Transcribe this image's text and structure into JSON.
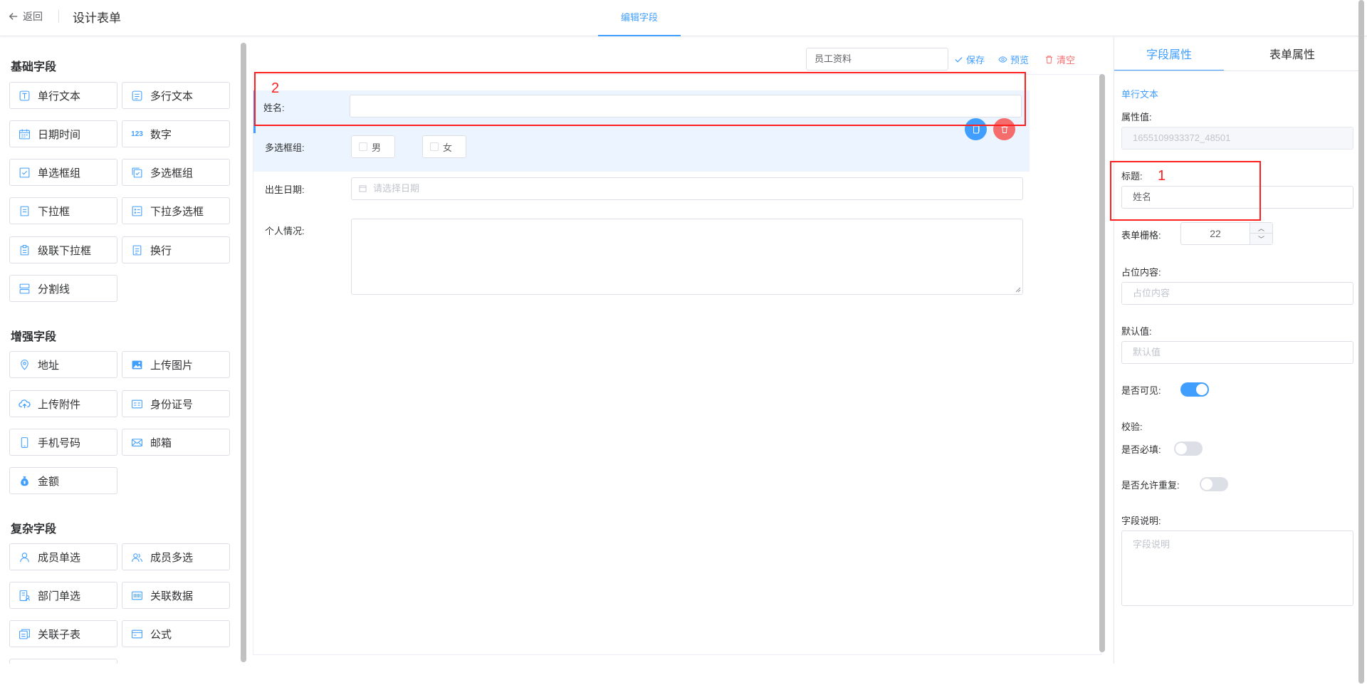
{
  "header": {
    "back_label": "返回",
    "title": "设计表单",
    "center_tab": "编辑字段"
  },
  "palette": {
    "groups": [
      {
        "title": "基础字段",
        "items": [
          {
            "label": "单行文本",
            "icon": "single-line-text-icon"
          },
          {
            "label": "多行文本",
            "icon": "multi-line-text-icon"
          },
          {
            "label": "日期时间",
            "icon": "calendar-icon"
          },
          {
            "label": "数字",
            "icon": "number-icon"
          },
          {
            "label": "单选框组",
            "icon": "radio-group-icon"
          },
          {
            "label": "多选框组",
            "icon": "checkbox-group-icon"
          },
          {
            "label": "下拉框",
            "icon": "dropdown-icon"
          },
          {
            "label": "下拉多选框",
            "icon": "multi-dropdown-icon"
          },
          {
            "label": "级联下拉框",
            "icon": "cascader-icon"
          },
          {
            "label": "换行",
            "icon": "line-break-icon"
          },
          {
            "label": "分割线",
            "icon": "divider-icon"
          }
        ]
      },
      {
        "title": "增强字段",
        "items": [
          {
            "label": "地址",
            "icon": "location-pin-icon"
          },
          {
            "label": "上传图片",
            "icon": "image-icon"
          },
          {
            "label": "上传附件",
            "icon": "cloud-upload-icon"
          },
          {
            "label": "身份证号",
            "icon": "id-card-icon"
          },
          {
            "label": "手机号码",
            "icon": "phone-icon"
          },
          {
            "label": "邮箱",
            "icon": "mail-icon"
          },
          {
            "label": "金额",
            "icon": "money-bag-icon"
          }
        ]
      },
      {
        "title": "复杂字段",
        "items": [
          {
            "label": "成员单选",
            "icon": "user-icon"
          },
          {
            "label": "成员多选",
            "icon": "users-icon"
          },
          {
            "label": "部门单选",
            "icon": "department-icon"
          },
          {
            "label": "关联数据",
            "icon": "barcode-icon"
          },
          {
            "label": "关联子表",
            "icon": "subtable-icon"
          },
          {
            "label": "公式",
            "icon": "formula-icon"
          }
        ]
      }
    ]
  },
  "toolbar": {
    "form_name": "员工资料",
    "save_label": "保存",
    "preview_label": "预览",
    "clear_label": "清空",
    "colors": {
      "primary": "#409eff",
      "danger": "#f56c6c"
    }
  },
  "canvas": {
    "fields": {
      "name": {
        "label": "姓名:"
      },
      "checkbox_group": {
        "label": "多选框组:",
        "options": [
          "男",
          "女"
        ]
      },
      "birth_date": {
        "label": "出生日期:",
        "placeholder": "请选择日期"
      },
      "personal": {
        "label": "个人情况:"
      }
    }
  },
  "annotations": [
    "1",
    "2"
  ],
  "properties": {
    "tabs": [
      "字段属性",
      "表单属性"
    ],
    "field_type": "单行文本",
    "attr_value_label": "属性值:",
    "attr_value": "1655109933372_48501",
    "title_label": "标题:",
    "title_value": "姓名",
    "grid_label": "表单栅格:",
    "grid_value": "22",
    "placeholder_label": "占位内容:",
    "placeholder_placeholder": "占位内容",
    "default_label": "默认值:",
    "default_placeholder": "默认值",
    "visible_label": "是否可见:",
    "visible": true,
    "validate_label": "校验:",
    "required_label": "是否必填:",
    "required": false,
    "unique_label": "是否允许重复:",
    "unique": false,
    "desc_label": "字段说明:",
    "desc_placeholder": "字段说明"
  }
}
